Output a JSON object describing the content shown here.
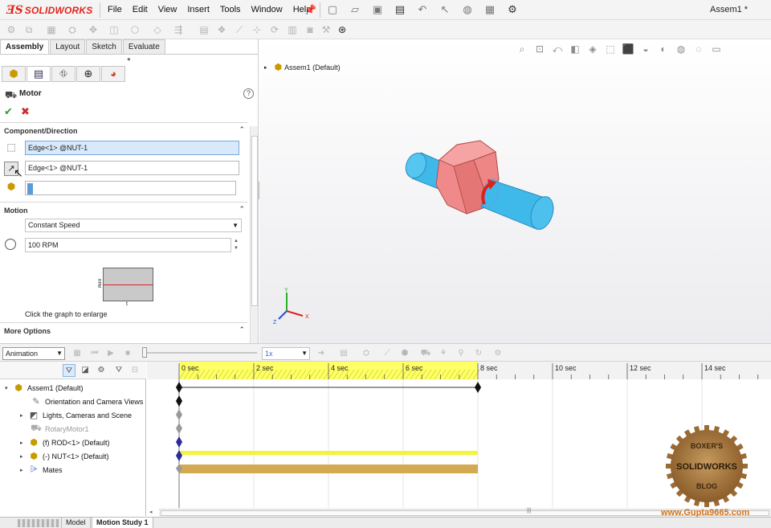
{
  "app": {
    "logo_ds": "ƎS",
    "logo_text": "SOLIDWORKS",
    "document_title": "Assem1 *",
    "menu": [
      "File",
      "Edit",
      "View",
      "Insert",
      "Tools",
      "Window",
      "Help"
    ],
    "quick_access_icons": [
      "new-icon",
      "open-icon",
      "save-icon",
      "print-icon",
      "undo-icon",
      "select-icon",
      "rebuild-icon",
      "file-properties-icon",
      "options-icon"
    ]
  },
  "panel": {
    "tabs": [
      "Assembly",
      "Layout",
      "Sketch",
      "Evaluate"
    ],
    "active_tab": "Assembly",
    "manager_tabs": [
      "featuremanager-icon",
      "propertymanager-icon",
      "configurationmanager-icon",
      "dimxpert-icon",
      "display-manager-icon"
    ],
    "title": "Motor",
    "sections": {
      "component_direction": "Component/Direction",
      "motion": "Motion",
      "more_options": "More Options"
    },
    "component_direction": {
      "location_value": "Edge<1> @NUT-1",
      "direction_value": "Edge<1> @NUT-1",
      "component_value": ""
    },
    "motion": {
      "type": "Constant Speed",
      "speed": "100 RPM",
      "graph_xlabel": "t",
      "graph_ylabel": "RPM",
      "graph_caption": "Click the graph to enlarge"
    }
  },
  "graphics": {
    "tree_root": "Assem1  (Default)",
    "triad_labels": {
      "x": "X",
      "y": "Y",
      "z": "Z"
    },
    "colors": {
      "nut": "#f08a8a",
      "rod": "#3fb8ea",
      "motor_arrow": "#e0201b"
    }
  },
  "motion_toolbar": {
    "study_type": "Animation",
    "playback_speed": "1x"
  },
  "motion_tree": {
    "items": [
      {
        "label": "Assem1  (Default)",
        "icon": "assembly-icon",
        "expand": "▾",
        "dim": false
      },
      {
        "label": "Orientation and Camera Views",
        "icon": "camera-icon",
        "expand": "",
        "dim": false
      },
      {
        "label": "Lights, Cameras and Scene",
        "icon": "lights-icon",
        "expand": "▸",
        "dim": false
      },
      {
        "label": "RotaryMotor1",
        "icon": "motor-icon",
        "expand": "",
        "dim": true
      },
      {
        "label": "(f) ROD<1> (Default)",
        "icon": "part-icon",
        "expand": "▸",
        "dim": false
      },
      {
        "label": "(-) NUT<1> (Default)",
        "icon": "part-icon",
        "expand": "▸",
        "dim": false
      },
      {
        "label": "Mates",
        "icon": "mates-icon",
        "expand": "▸",
        "dim": false
      }
    ]
  },
  "timeline": {
    "tick_labels": [
      "0 sec",
      "2 sec",
      "4 sec",
      "6 sec",
      "8 sec",
      "10 sec",
      "12 sec",
      "14 sec"
    ],
    "duration_sec": 8,
    "colors": {
      "ruler_active": "#ffff66",
      "key_bar_rod": "#f4f43a",
      "key_bar_nut": "#d4aa50"
    }
  },
  "bottom_tabs": [
    "Model",
    "Motion Study 1"
  ],
  "active_bottom_tab": "Motion Study 1",
  "watermark": {
    "stamp_top": "BOXER'S",
    "stamp_mid": "SOLIDWORKS",
    "stamp_bottom": "BLOG",
    "website": "www.Gupta9665.com"
  }
}
